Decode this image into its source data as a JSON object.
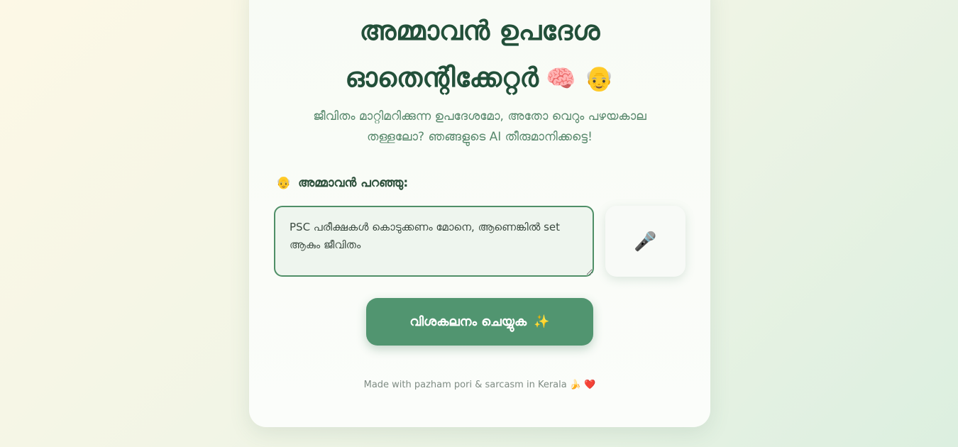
{
  "header": {
    "title_line1": "അമ്മാവൻ ഉപദേശ",
    "title_line2": "ഓതെന്റിക്കേറ്റർ",
    "title_emojis": "🧠 👴",
    "subtitle_line1": "ജീവിതം മാറ്റിമറിക്കുന്ന ഉപദേശമോ, അതോ വെറും പഴയകാല",
    "subtitle_line2": "തള്ളലോ? ഞങ്ങളുടെ AI തീരുമാനിക്കട്ടെ!"
  },
  "form": {
    "label_emoji": "👴",
    "label": "അമ്മാവൻ പറഞ്ഞു:",
    "input_value": "PSC പരീക്ഷകൾ കൊടുക്കണം മോനെ, ആണെങ്കിൽ set ആകും ജീവിതം",
    "mic_glyph": "🎤",
    "analyze_label": "വിശകലനം ചെയ്യുക",
    "analyze_emoji": "✨"
  },
  "footer": {
    "text": "Made with pazham pori & sarcasm in Kerala 🍌 ❤️"
  },
  "colors": {
    "primary": "#519570",
    "title": "#23503a",
    "subtitle": "#5a8a6e"
  }
}
